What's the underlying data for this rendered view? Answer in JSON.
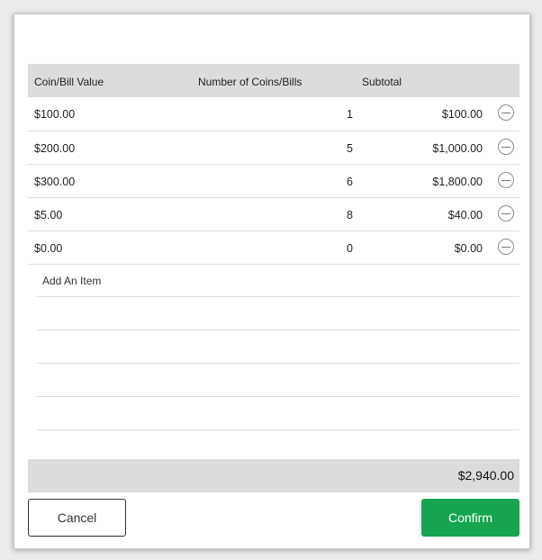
{
  "table": {
    "headers": {
      "value": "Coin/Bill Value",
      "count": "Number of Coins/Bills",
      "subtotal": "Subtotal"
    },
    "rows": [
      {
        "value": "$100.00",
        "count": "1",
        "subtotal": "$100.00"
      },
      {
        "value": "$200.00",
        "count": "5",
        "subtotal": "$1,000.00"
      },
      {
        "value": "$300.00",
        "count": "6",
        "subtotal": "$1,800.00"
      },
      {
        "value": "$5.00",
        "count": "8",
        "subtotal": "$40.00"
      },
      {
        "value": "$0.00",
        "count": "0",
        "subtotal": "$0.00"
      }
    ],
    "add_item_label": "Add An Item",
    "total": "$2,940.00"
  },
  "actions": {
    "cancel_label": "Cancel",
    "confirm_label": "Confirm"
  },
  "colors": {
    "confirm": "#17a552",
    "header_bg": "#dcdcdc"
  },
  "icons": {
    "remove": "minus-circle-icon"
  }
}
